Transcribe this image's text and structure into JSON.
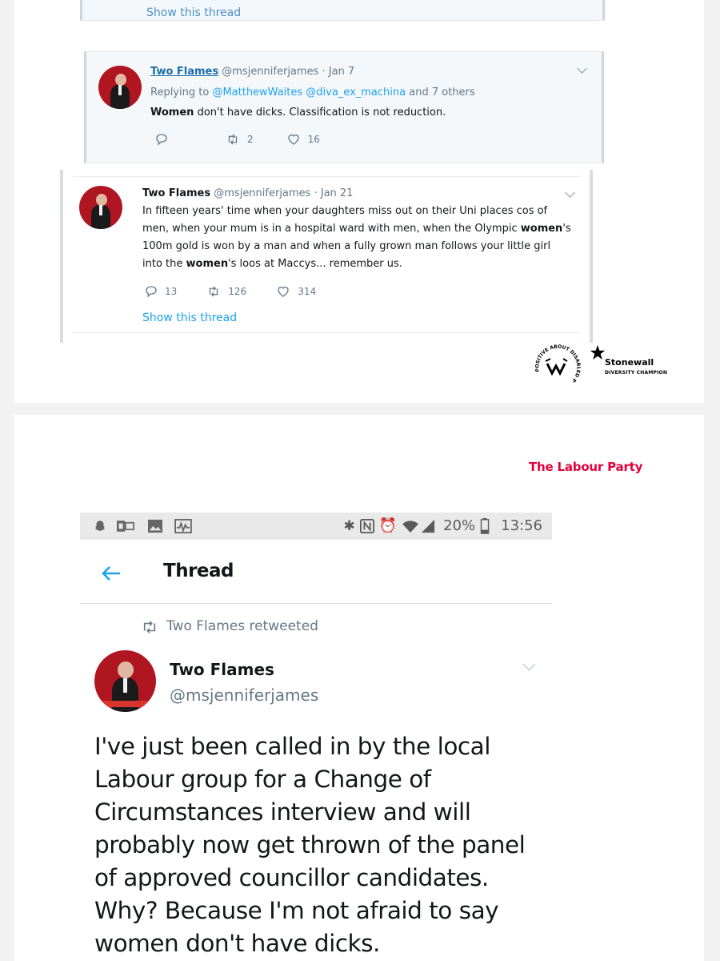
{
  "top_screenshot": {
    "prev_tweet": {
      "show_thread": "Show this thread"
    },
    "reply_tweet": {
      "name": "Two Flames",
      "handle_date": "@msjenniferjames · Jan 7",
      "replying_prefix": "Replying to",
      "replying_to": "@MatthewWaites @diva_ex_machina",
      "replying_suffix": "and 7 others",
      "text_bold": "Women",
      "text_rest": " don't have dicks. Classification is not reduction.",
      "retweets": "2",
      "likes": "16"
    },
    "main_tweet": {
      "name": "Two Flames",
      "handle_date": "@msjenniferjames · Jan 21",
      "line1": "In fifteen years' time when your daughters miss out on their Uni places cos of",
      "line2_a": "men, when your mum is in a hospital ward with men, when the Olympic ",
      "line2_bold": "women",
      "line2_b": "'s",
      "line3": "100m gold is won by a man and when a fully grown man follows your little girl",
      "line4_a": "into the ",
      "line4_bold": "women",
      "line4_b": "'s loos at Maccys... remember us.",
      "replies": "13",
      "retweets": "126",
      "likes": "314",
      "show_thread": "Show this thread"
    },
    "badges": {
      "disability_arc_text": "POSITIVE ABOUT DISABLED PEOPLE",
      "stonewall": "Stonewall",
      "stonewall_sub": "DIVERSITY CHAMPION"
    }
  },
  "bottom_screenshot": {
    "party_logo": "The Labour Party",
    "status_bar": {
      "battery": "20%",
      "time": "13:56"
    },
    "header": {
      "title": "Thread"
    },
    "retweet_context": "Two Flames retweeted",
    "tweet": {
      "name": "Two Flames",
      "handle": "@msjenniferjames",
      "text_lines": [
        "I've just been called in by the local",
        "Labour group for a Change of",
        "Circumstances interview and will",
        "probably now get thrown of the panel",
        "of approved councillor candidates.",
        "Why? Because I'm not afraid to say",
        "women don't have dicks."
      ]
    }
  },
  "colors": {
    "twitter_blue": "#1da1f2",
    "labour_red": "#e4003b",
    "meta_gray": "#657786"
  }
}
